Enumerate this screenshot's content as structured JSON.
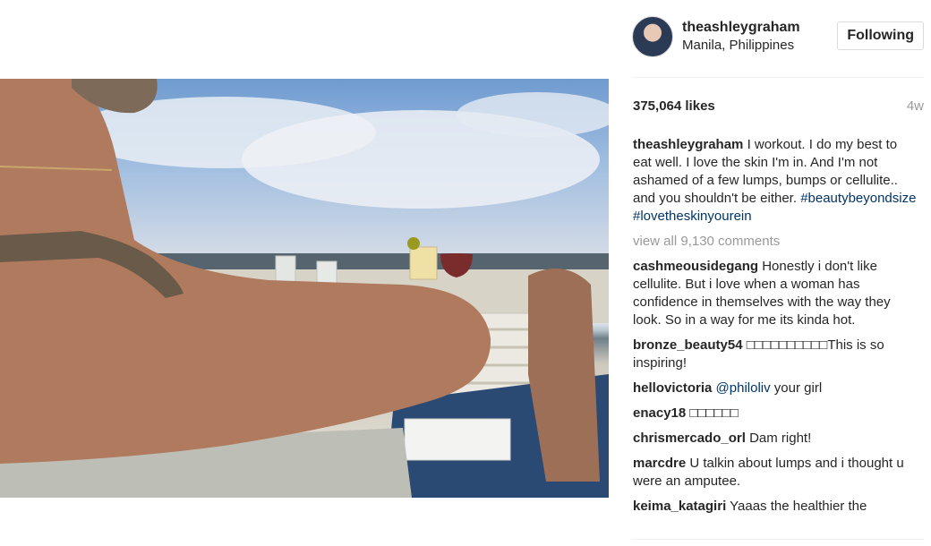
{
  "post": {
    "image_alt": "Beach photo",
    "author": "theashleygraham",
    "location": "Manila, Philippines",
    "follow_label": "Following",
    "likes": "375,064 likes",
    "age": "4w",
    "caption": "I workout. I do my best to eat well. I love the skin I'm in. And I'm not ashamed of a few lumps, bumps or cellulite.. and you shouldn't be either.",
    "hashtags": "#beautybeyondsize #lovetheskinyourein",
    "view_all": "view all 9,130 comments"
  },
  "comments": [
    {
      "user": "cashmeousidegang",
      "text": "Honestly i don't like cellulite. But i love when a woman has confidence in themselves with the way they look. So in a way for me its kinda hot."
    },
    {
      "user": "bronze_beauty54",
      "text": "□□□□□□□□□□This is so inspiring!"
    },
    {
      "user": "hellovictoria",
      "mention": "@philoliv",
      "text": "your girl"
    },
    {
      "user": "enacy18",
      "text": "□□□□□□"
    },
    {
      "user": "chrismercado_orl",
      "text": "Dam right!"
    },
    {
      "user": "marcdre",
      "text": "U talkin about lumps and i thought u were an amputee."
    },
    {
      "user": "keima_katagiri",
      "text": "Yaaas the healthier the"
    }
  ],
  "colors": {
    "link": "#003569",
    "muted": "#999999",
    "border": "#dbdbdb"
  },
  "icons": {
    "avatar": "profile-avatar"
  }
}
